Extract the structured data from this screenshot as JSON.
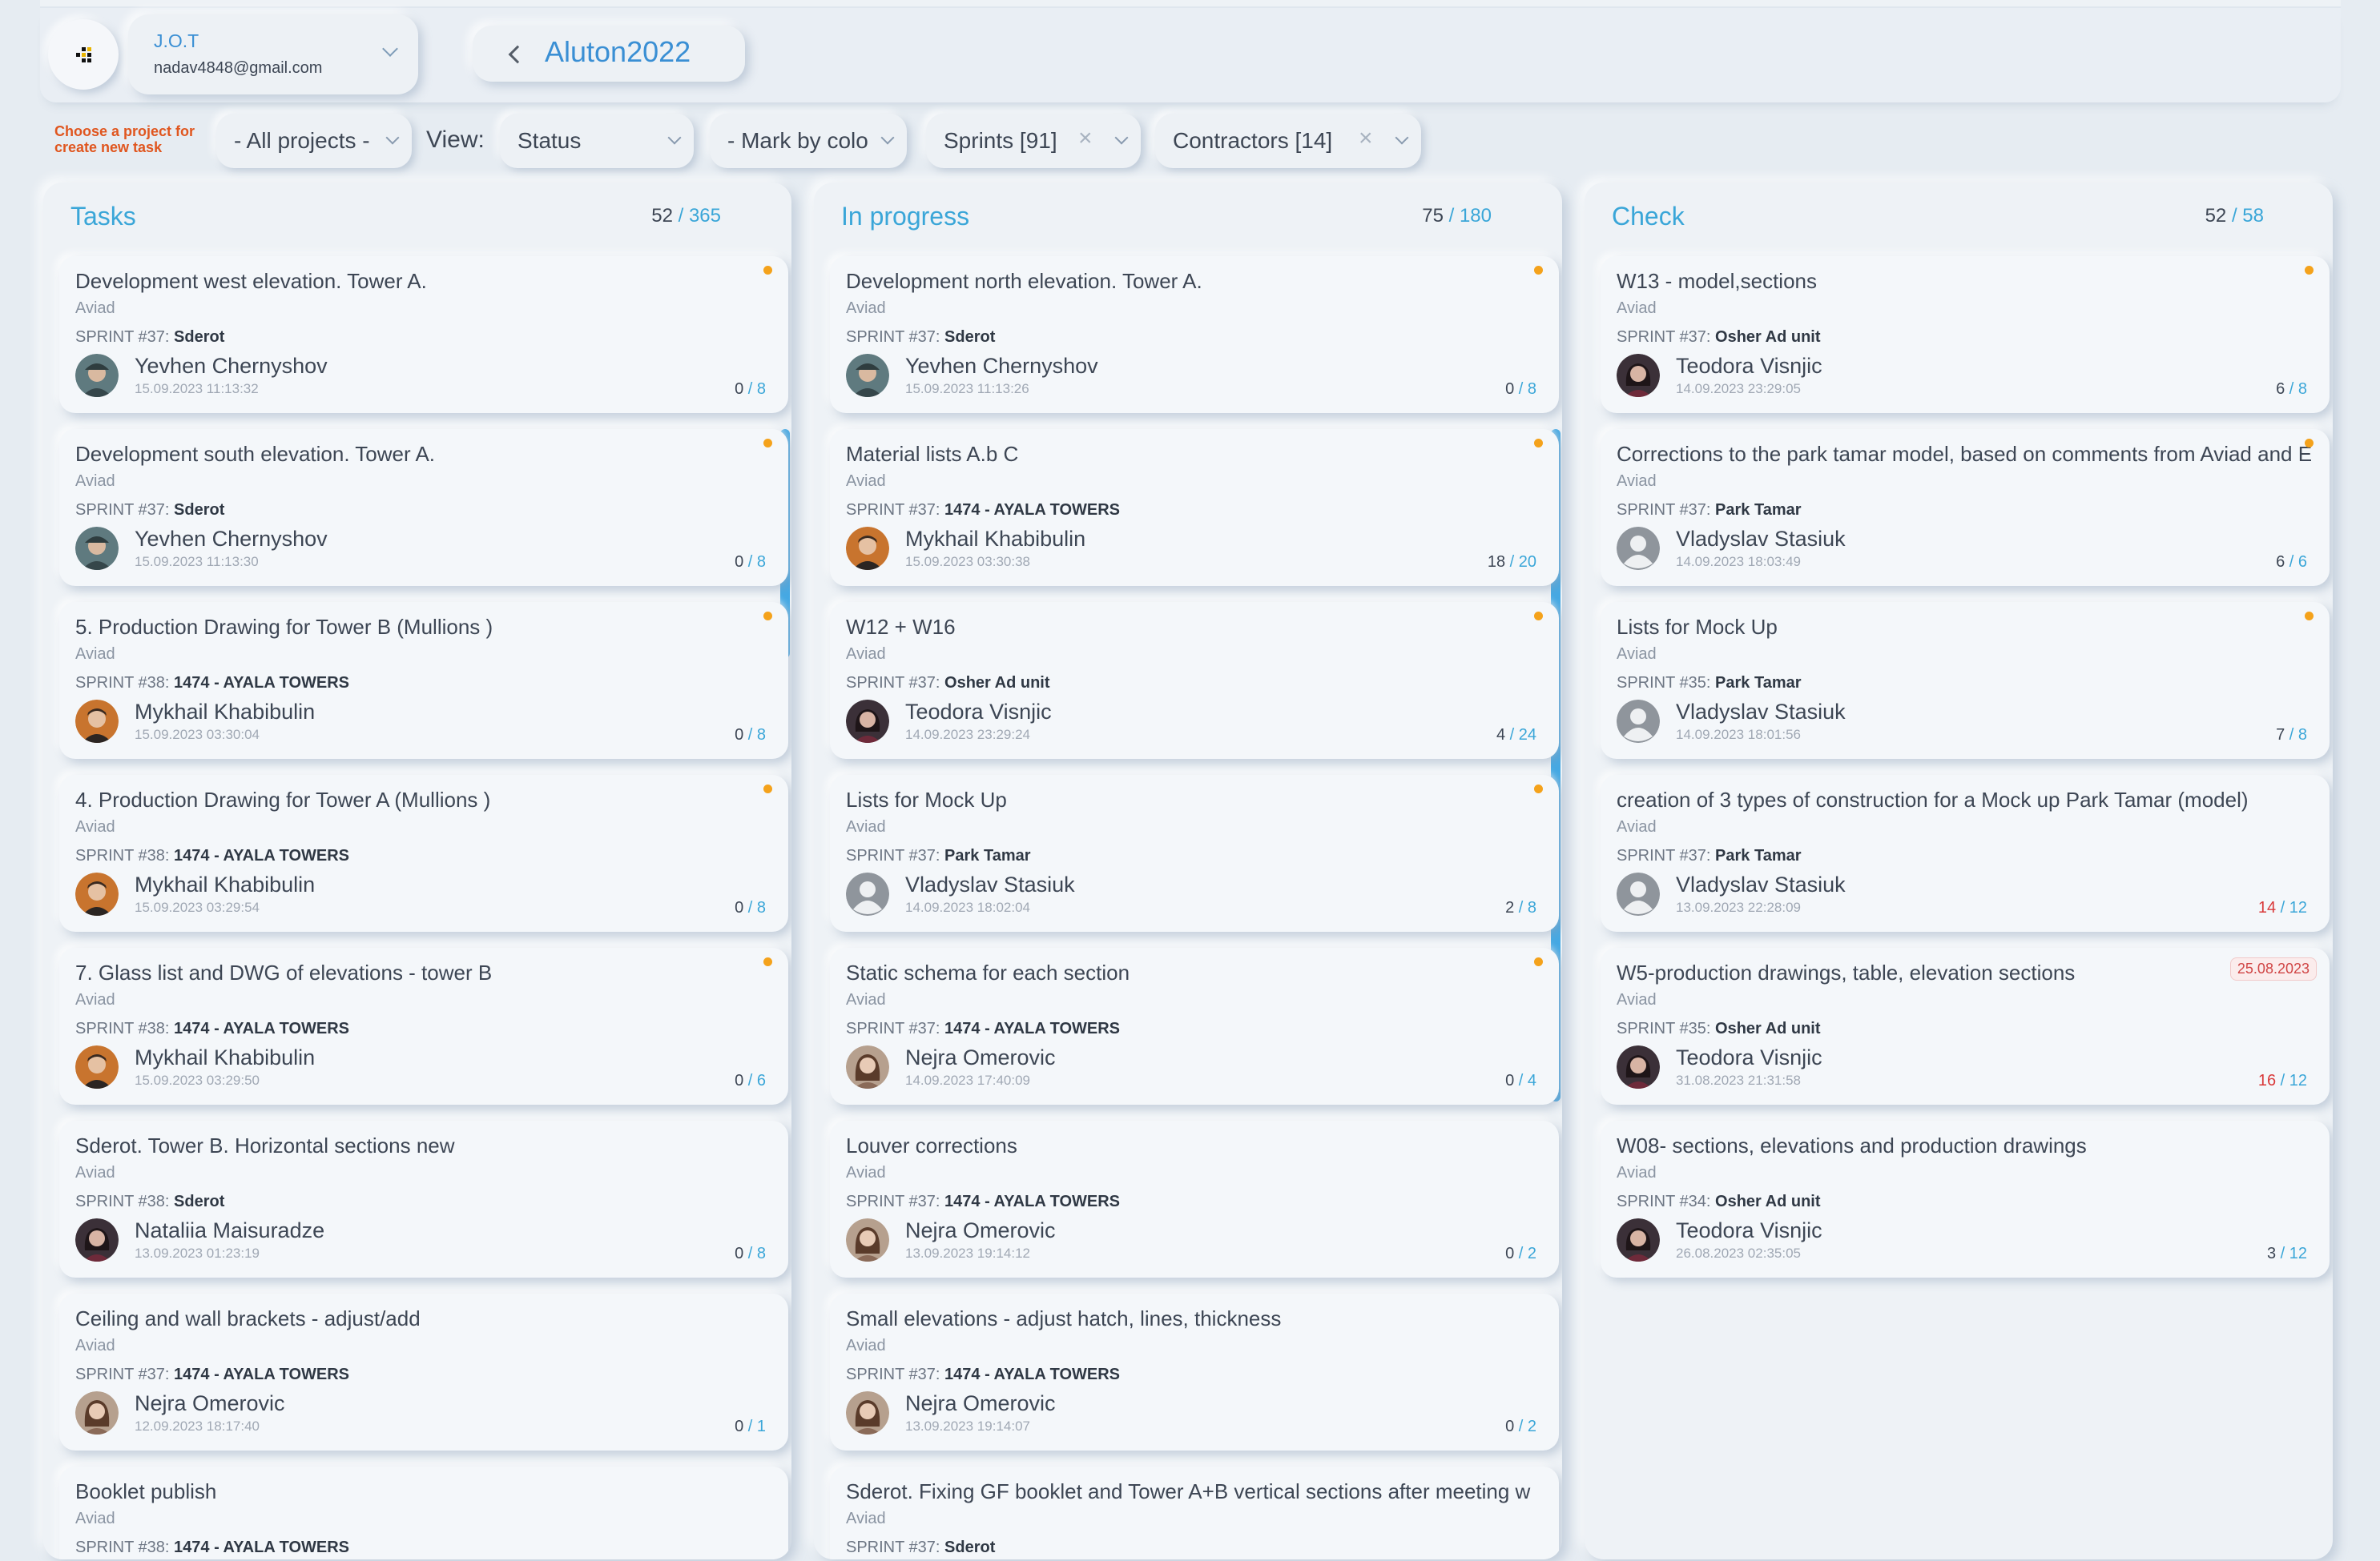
{
  "header": {
    "user": {
      "name": "J.O.T",
      "email": "nadav4848@gmail.com"
    },
    "project": {
      "name": "Aluton2022"
    }
  },
  "filters": {
    "hint": "Choose a project for create new task",
    "projects": "- All projects -",
    "view_label": "View:",
    "view": "Status",
    "mark_by_color": "- Mark by colo",
    "sprints": "Sprints [91]",
    "contractors": "Contractors [14]"
  },
  "columns": [
    {
      "title": "Tasks",
      "count_shown": "52",
      "count_total": "365",
      "cards": [
        {
          "title": "Development west elevation. Tower A.",
          "client": "Aviad",
          "sprint": "SPRINT #37: ",
          "sprint_name": "Sderot",
          "person": "Yevhen Chernyshov",
          "date": "15.09.2023 11:13:32",
          "done": "0",
          "total": "8",
          "flag": "dot",
          "avatar": "hat"
        },
        {
          "title": "Development south elevation. Tower A.",
          "client": "Aviad",
          "sprint": "SPRINT #37: ",
          "sprint_name": "Sderot",
          "person": "Yevhen Chernyshov",
          "date": "15.09.2023 11:13:30",
          "done": "0",
          "total": "8",
          "flag": "dot",
          "avatar": "hat"
        },
        {
          "title": "5. Production Drawing for Tower B (Mullions )",
          "client": "Aviad",
          "sprint": "SPRINT #38: ",
          "sprint_name": "1474 - AYALA TOWERS",
          "person": "Mykhail Khabibulin",
          "date": "15.09.2023 03:30:04",
          "done": "0",
          "total": "8",
          "flag": "dot",
          "avatar": "orange"
        },
        {
          "title": "4. Production Drawing for Tower A (Mullions )",
          "client": "Aviad",
          "sprint": "SPRINT #38: ",
          "sprint_name": "1474 - AYALA TOWERS",
          "person": "Mykhail Khabibulin",
          "date": "15.09.2023 03:29:54",
          "done": "0",
          "total": "8",
          "flag": "dot",
          "avatar": "orange"
        },
        {
          "title": "7. Glass list and DWG of elevations - tower B",
          "client": "Aviad",
          "sprint": "SPRINT #38: ",
          "sprint_name": "1474 - AYALA TOWERS",
          "person": "Mykhail Khabibulin",
          "date": "15.09.2023 03:29:50",
          "done": "0",
          "total": "6",
          "flag": "dot",
          "avatar": "orange"
        },
        {
          "title": "Sderot. Tower B. Horizontal sections new",
          "client": "Aviad",
          "sprint": "SPRINT #38: ",
          "sprint_name": "Sderot",
          "person": "Nataliia Maisuradze",
          "date": "13.09.2023 01:23:19",
          "done": "0",
          "total": "8",
          "flag": "",
          "avatar": "dark"
        },
        {
          "title": "Ceiling and wall brackets - adjust/add",
          "client": "Aviad",
          "sprint": "SPRINT #37: ",
          "sprint_name": "1474 - AYALA TOWERS",
          "person": "Nejra Omerovic",
          "date": "12.09.2023 18:17:40",
          "done": "0",
          "total": "1",
          "flag": "",
          "avatar": "light"
        },
        {
          "title": "Booklet publish",
          "client": "Aviad",
          "sprint": "SPRINT #38: ",
          "sprint_name": "1474 - AYALA TOWERS",
          "person": "",
          "date": "",
          "done": "",
          "total": "",
          "flag": "",
          "avatar": ""
        }
      ]
    },
    {
      "title": "In progress",
      "count_shown": "75",
      "count_total": "180",
      "cards": [
        {
          "title": "Development north elevation. Tower A.",
          "client": "Aviad",
          "sprint": "SPRINT #37: ",
          "sprint_name": "Sderot",
          "person": "Yevhen Chernyshov",
          "date": "15.09.2023 11:13:26",
          "done": "0",
          "total": "8",
          "flag": "dot",
          "avatar": "hat"
        },
        {
          "title": "Material lists A.b C",
          "client": "Aviad",
          "sprint": "SPRINT #37: ",
          "sprint_name": "1474 - AYALA TOWERS",
          "person": "Mykhail Khabibulin",
          "date": "15.09.2023 03:30:38",
          "done": "18",
          "total": "20",
          "flag": "dot",
          "avatar": "orange"
        },
        {
          "title": "W12 + W16",
          "client": "Aviad",
          "sprint": "SPRINT #37: ",
          "sprint_name": "Osher Ad unit",
          "person": "Teodora Visnjic",
          "date": "14.09.2023 23:29:24",
          "done": "4",
          "total": "24",
          "flag": "dot",
          "avatar": "dark"
        },
        {
          "title": "Lists for Mock Up",
          "client": "Aviad",
          "sprint": "SPRINT #37: ",
          "sprint_name": "Park Tamar",
          "person": "Vladyslav Stasiuk",
          "date": "14.09.2023 18:02:04",
          "done": "2",
          "total": "8",
          "flag": "dot",
          "avatar": "placeholder"
        },
        {
          "title": "Static schema for each section",
          "client": "Aviad",
          "sprint": "SPRINT #37: ",
          "sprint_name": "1474 - AYALA TOWERS",
          "person": "Nejra Omerovic",
          "date": "14.09.2023 17:40:09",
          "done": "0",
          "total": "4",
          "flag": "dot",
          "avatar": "light"
        },
        {
          "title": "Louver corrections",
          "client": "Aviad",
          "sprint": "SPRINT #37: ",
          "sprint_name": "1474 - AYALA TOWERS",
          "person": "Nejra Omerovic",
          "date": "13.09.2023 19:14:12",
          "done": "0",
          "total": "2",
          "flag": "",
          "avatar": "light"
        },
        {
          "title": "Small elevations - adjust hatch, lines, thickness",
          "client": "Aviad",
          "sprint": "SPRINT #37: ",
          "sprint_name": "1474 - AYALA TOWERS",
          "person": "Nejra Omerovic",
          "date": "13.09.2023 19:14:07",
          "done": "0",
          "total": "2",
          "flag": "",
          "avatar": "light"
        },
        {
          "title": "Sderot. Fixing GF booklet and Tower A+B vertical sections after meeting w",
          "client": "Aviad",
          "sprint": "SPRINT #37: ",
          "sprint_name": "Sderot",
          "person": "",
          "date": "",
          "done": "",
          "total": "",
          "flag": "",
          "avatar": ""
        }
      ]
    },
    {
      "title": "Check",
      "count_shown": "52",
      "count_total": "58",
      "cards": [
        {
          "title": "W13 - model,sections",
          "client": "Aviad",
          "sprint": "SPRINT #37: ",
          "sprint_name": "Osher Ad unit",
          "person": "Teodora Visnjic",
          "date": "14.09.2023 23:29:05",
          "done": "6",
          "total": "8",
          "flag": "dot",
          "avatar": "dark"
        },
        {
          "title": "Corrections to the park tamar model, based on comments from Aviad and E",
          "client": "Aviad",
          "sprint": "SPRINT #37: ",
          "sprint_name": "Park Tamar",
          "person": "Vladyslav Stasiuk",
          "date": "14.09.2023 18:03:49",
          "done": "6",
          "total": "6",
          "flag": "dot",
          "avatar": "placeholder"
        },
        {
          "title": "Lists for Mock Up",
          "client": "Aviad",
          "sprint": "SPRINT #35: ",
          "sprint_name": "Park Tamar",
          "person": "Vladyslav Stasiuk",
          "date": "14.09.2023 18:01:56",
          "done": "7",
          "total": "8",
          "flag": "dot",
          "avatar": "placeholder"
        },
        {
          "title": "creation of 3 types of construction for a Mock up Park Tamar (model)",
          "client": "Aviad",
          "sprint": "SPRINT #37: ",
          "sprint_name": "Park Tamar",
          "person": "Vladyslav Stasiuk",
          "date": "13.09.2023 22:28:09",
          "done": "14",
          "total": "12",
          "flag": "",
          "avatar": "placeholder",
          "over": true
        },
        {
          "title": "W5-production drawings, table, elevation sections",
          "client": "Aviad",
          "sprint": "SPRINT #35: ",
          "sprint_name": "Osher Ad unit",
          "person": "Teodora Visnjic",
          "date": "31.08.2023 21:31:58",
          "done": "16",
          "total": "12",
          "flag": "badge",
          "badge": "25.08.2023",
          "avatar": "dark",
          "over": true
        },
        {
          "title": "W08- sections, elevations and production drawings",
          "client": "Aviad",
          "sprint": "SPRINT #34: ",
          "sprint_name": "Osher Ad unit",
          "person": "Teodora Visnjic",
          "date": "26.08.2023 02:35:05",
          "done": "3",
          "total": "12",
          "flag": "",
          "avatar": "dark"
        }
      ]
    }
  ],
  "colors": {
    "accent": "#3aa6d8",
    "dot": "#f4a21b",
    "overdue": "#d93a3a",
    "hint": "#e0561f",
    "scrollbar": "#45a9e4"
  }
}
